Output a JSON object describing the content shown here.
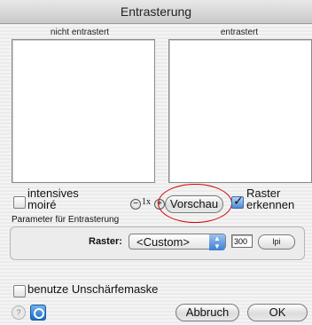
{
  "window": {
    "title": "Entrasterung"
  },
  "previews": {
    "left_label": "nicht entrastert",
    "right_label": "entrastert"
  },
  "controls": {
    "intensive_moire_label_line1": "intensives",
    "intensive_moire_label_line2": "moiré",
    "intensive_moire_checked": false,
    "zoom_label": "1x",
    "preview_button_label": "Vorschau",
    "detect_screen_label_line1": "Raster",
    "detect_screen_label_line2": "erkennen",
    "detect_screen_checked": true
  },
  "parameters": {
    "group_title": "Parameter für Entrasterung",
    "raster_label": "Raster:",
    "raster_value": "<Custom>",
    "raster_number": "300",
    "unit_button_label": "lpi"
  },
  "footer": {
    "unsharp_mask_label": "benutze Unschärfemaske",
    "unsharp_mask_checked": false,
    "cancel_label": "Abbruch",
    "ok_label": "OK"
  },
  "icons": {
    "zoom_out": "zoom-out-icon",
    "zoom_in": "zoom-in-icon",
    "help": "help-icon",
    "app": "app-icon"
  },
  "colors": {
    "annotation": "#d40000",
    "accent_blue": "#3d7fd6"
  }
}
